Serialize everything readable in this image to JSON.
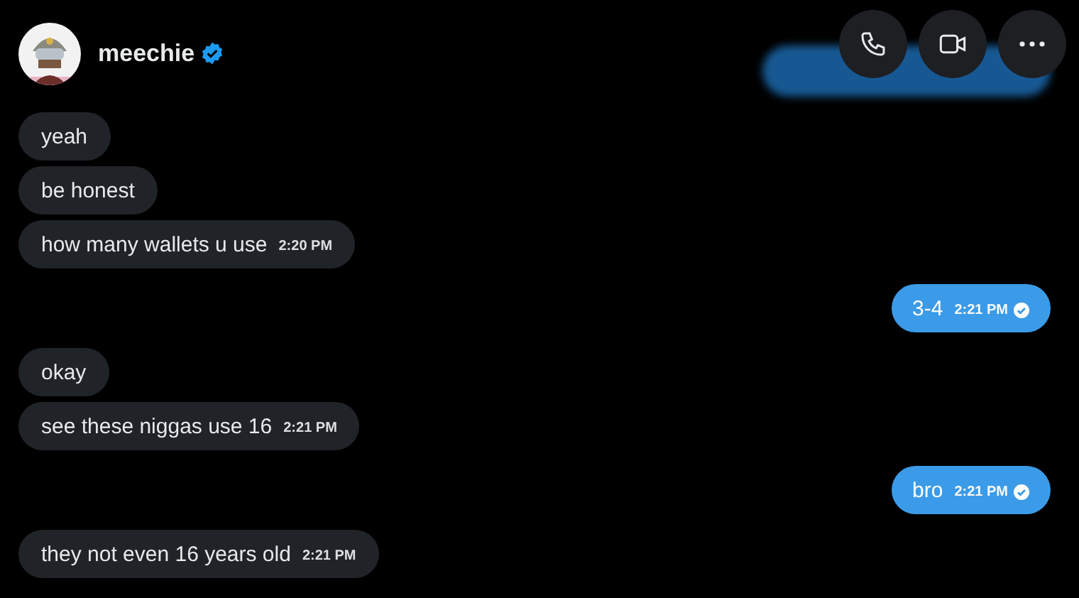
{
  "header": {
    "name": "meechie",
    "verified": true
  },
  "messages": [
    {
      "kind": "received",
      "text": "yeah"
    },
    {
      "kind": "received",
      "text": "be honest"
    },
    {
      "kind": "received",
      "text": "how many wallets u use",
      "time": "2:20 PM"
    },
    {
      "kind": "sent",
      "text": "3-4",
      "time": "2:21 PM",
      "read": true
    },
    {
      "kind": "received",
      "text": "okay"
    },
    {
      "kind": "received",
      "text": "see these niggas use 16",
      "time": "2:21 PM"
    },
    {
      "kind": "sent",
      "text": "bro",
      "time": "2:21 PM",
      "read": true
    },
    {
      "kind": "received",
      "text": "they not even 16 years old",
      "time": "2:21 PM"
    }
  ]
}
